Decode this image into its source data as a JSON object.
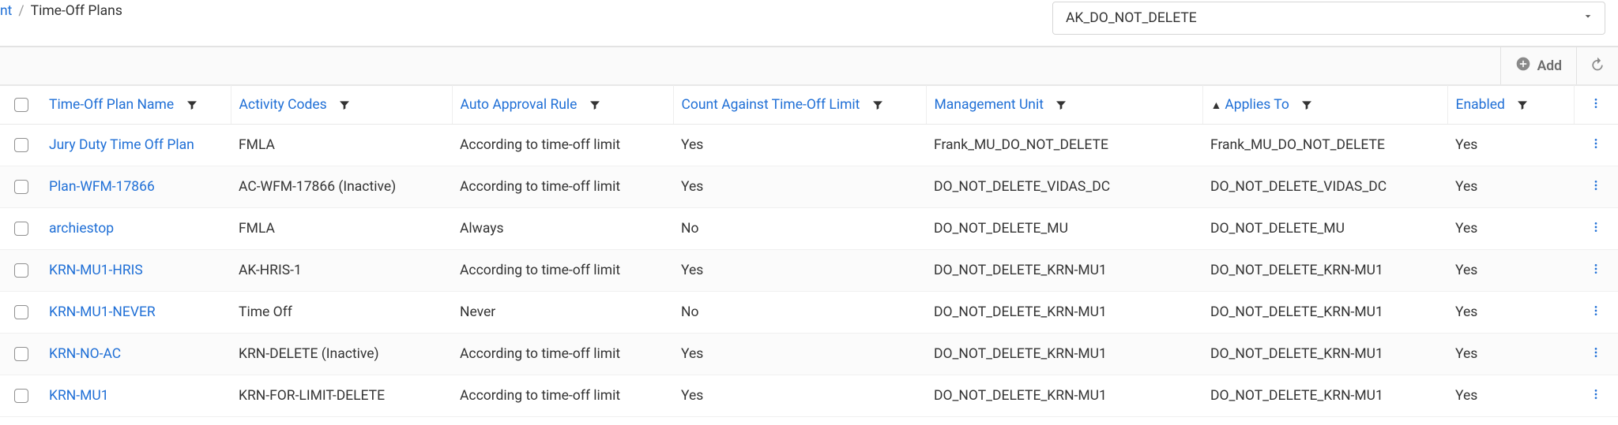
{
  "breadcrumb": {
    "prev_fragment": "nt",
    "separator": "/",
    "current": "Time-Off Plans"
  },
  "dropdown": {
    "selected": "AK_DO_NOT_DELETE"
  },
  "toolbar": {
    "add_label": "Add"
  },
  "columns": {
    "name": "Time-Off Plan Name",
    "activity": "Activity Codes",
    "auto": "Auto Approval Rule",
    "count": "Count Against Time-Off Limit",
    "mgmt": "Management Unit",
    "applies": "Applies To",
    "enabled": "Enabled"
  },
  "sort": {
    "column": "applies",
    "direction": "asc"
  },
  "rows": [
    {
      "name": "Jury Duty Time Off Plan",
      "activity": "FMLA",
      "auto": "According to time-off limit",
      "count": "Yes",
      "mgmt": "Frank_MU_DO_NOT_DELETE",
      "applies": "Frank_MU_DO_NOT_DELETE",
      "enabled": "Yes"
    },
    {
      "name": "Plan-WFM-17866",
      "activity": "AC-WFM-17866 (Inactive)",
      "auto": "According to time-off limit",
      "count": "Yes",
      "mgmt": "DO_NOT_DELETE_VIDAS_DC",
      "applies": "DO_NOT_DELETE_VIDAS_DC",
      "enabled": "Yes"
    },
    {
      "name": "archiestop",
      "activity": "FMLA",
      "auto": "Always",
      "count": "No",
      "mgmt": "DO_NOT_DELETE_MU",
      "applies": "DO_NOT_DELETE_MU",
      "enabled": "Yes"
    },
    {
      "name": "KRN-MU1-HRIS",
      "activity": "AK-HRIS-1",
      "auto": "According to time-off limit",
      "count": "Yes",
      "mgmt": "DO_NOT_DELETE_KRN-MU1",
      "applies": "DO_NOT_DELETE_KRN-MU1",
      "enabled": "Yes"
    },
    {
      "name": "KRN-MU1-NEVER",
      "activity": "Time Off",
      "auto": "Never",
      "count": "No",
      "mgmt": "DO_NOT_DELETE_KRN-MU1",
      "applies": "DO_NOT_DELETE_KRN-MU1",
      "enabled": "Yes"
    },
    {
      "name": "KRN-NO-AC",
      "activity": "KRN-DELETE (Inactive)",
      "auto": "According to time-off limit",
      "count": "Yes",
      "mgmt": "DO_NOT_DELETE_KRN-MU1",
      "applies": "DO_NOT_DELETE_KRN-MU1",
      "enabled": "Yes"
    },
    {
      "name": "KRN-MU1",
      "activity": "KRN-FOR-LIMIT-DELETE",
      "auto": "According to time-off limit",
      "count": "Yes",
      "mgmt": "DO_NOT_DELETE_KRN-MU1",
      "applies": "DO_NOT_DELETE_KRN-MU1",
      "enabled": "Yes"
    }
  ]
}
